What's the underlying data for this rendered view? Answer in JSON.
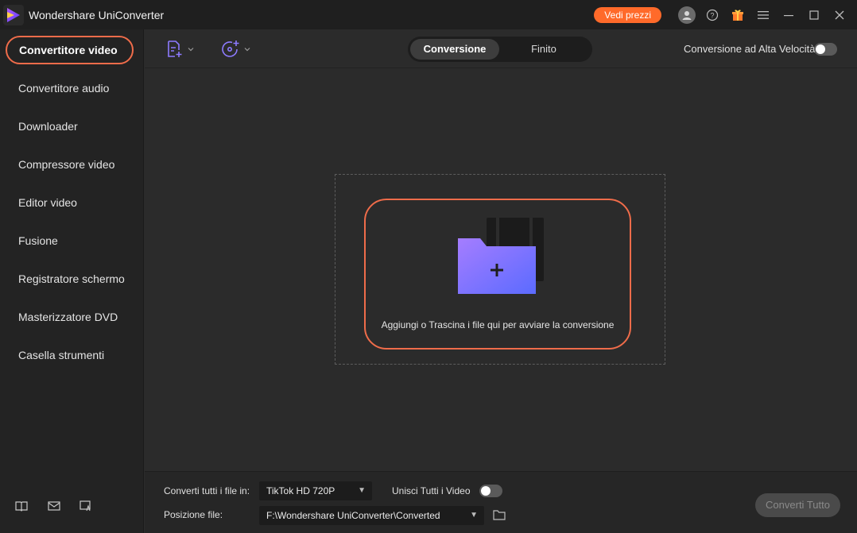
{
  "app": {
    "title": "Wondershare UniConverter"
  },
  "titlebar": {
    "price_label": "Vedi prezzi",
    "icons": [
      "user-icon",
      "help-icon",
      "gift-icon",
      "menu-icon",
      "minimize-icon",
      "maximize-icon",
      "close-icon"
    ]
  },
  "sidebar": {
    "active": "Convertitore video",
    "items": [
      {
        "label": "Convertitore audio"
      },
      {
        "label": "Downloader"
      },
      {
        "label": "Compressore video"
      },
      {
        "label": "Editor video"
      },
      {
        "label": "Fusione"
      },
      {
        "label": "Registratore schermo"
      },
      {
        "label": "Masterizzatore DVD"
      },
      {
        "label": "Casella strumenti"
      }
    ],
    "bottom_icons": [
      "guide-book-icon",
      "mail-icon",
      "feedback-icon"
    ]
  },
  "toolbar": {
    "tabs": [
      {
        "label": "Conversione",
        "active": true
      },
      {
        "label": "Finito",
        "active": false
      }
    ],
    "speed_label": "Conversione ad Alta Velocità",
    "speed_enabled": false
  },
  "drop": {
    "text": "Aggiungi o Trascina i file qui per avviare la conversione"
  },
  "bottom": {
    "convert_to_label": "Converti tutti i file in:",
    "format_value": "TikTok HD 720P",
    "merge_label": "Unisci Tutti i Video",
    "merge_enabled": false,
    "location_label": "Posizione file:",
    "location_value": "F:\\Wondershare UniConverter\\Converted",
    "convert_all_label": "Converti Tutto"
  },
  "colors": {
    "accent": "#ef6c4a",
    "price": "#ff6a2a",
    "purple": "#8d7bff",
    "folder": "#7b6cff"
  }
}
